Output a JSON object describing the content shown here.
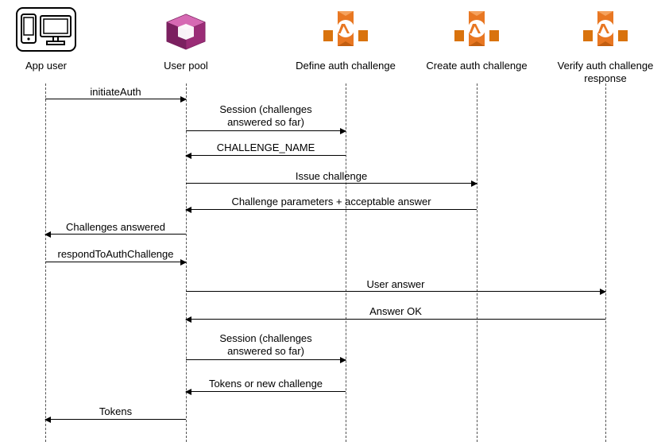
{
  "participants": {
    "appuser": {
      "label": "App user"
    },
    "userpool": {
      "label": "User pool"
    },
    "define": {
      "label": "Define auth challenge"
    },
    "create": {
      "label": "Create auth challenge"
    },
    "verify": {
      "label": "Verify auth challenge\nresponse"
    }
  },
  "messages": {
    "m1": "initiateAuth",
    "m2": "Session (challenges\nanswered so far)",
    "m3": "CHALLENGE_NAME",
    "m4": "Issue challenge",
    "m5": "Challenge parameters + acceptable answer",
    "m6": "Challenges answered",
    "m7": "respondToAuthChallenge",
    "m8": "User answer",
    "m9": "Answer OK",
    "m10": "Session (challenges\nanswered so far)",
    "m11": "Tokens or new challenge",
    "m12": "Tokens"
  }
}
